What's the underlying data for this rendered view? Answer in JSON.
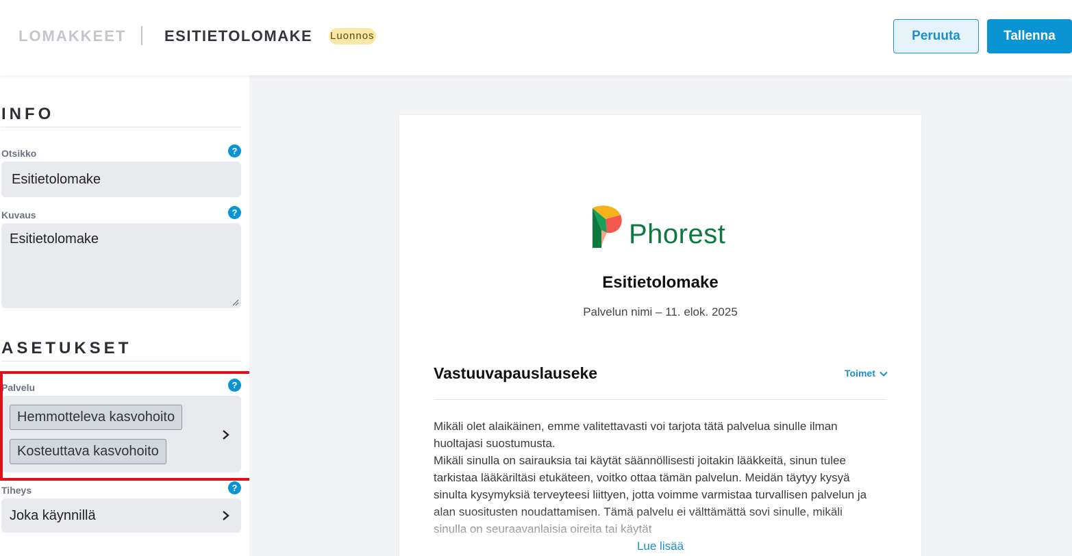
{
  "header": {
    "breadcrumb_root": "LOMAKKEET",
    "breadcrumb_current": "ESITIETOLOMAKE",
    "status_badge": "Luonnos",
    "cancel_label": "Peruuta",
    "save_label": "Tallenna"
  },
  "sidebar": {
    "info_title": "INFO",
    "title_label": "Otsikko",
    "title_value": "Esitietolomake",
    "description_label": "Kuvaus",
    "description_value": "Esitietolomake",
    "settings_title": "ASETUKSET",
    "service_label": "Palvelu",
    "services": [
      "Hemmotteleva kasvohoito",
      "Kosteuttava kasvohoito"
    ],
    "frequency_label": "Tiheys",
    "frequency_value": "Joka käynnillä",
    "help_glyph": "?"
  },
  "preview": {
    "logo_text": "Phorest",
    "form_title": "Esitietolomake",
    "form_subtitle": "Palvelun nimi – 11. elok. 2025",
    "block_title": "Vastuuvapauslauseke",
    "actions_label": "Toimet",
    "paragraph_1": "Mikäli olet alaikäinen, emme valitettavasti voi tarjota tätä palvelua sinulle ilman huoltajasi suostumusta.",
    "paragraph_2": "Mikäli sinulla on sairauksia tai käytät säännöllisesti joitakin lääkkeitä, sinun tulee tarkistaa lääkäriltäsi etukäteen, voitko ottaa tämän palvelun. Meidän täytyy kysyä sinulta kysymyksiä terveyteesi liittyen, jotta voimme varmistaa turvallisen palvelun ja alan suositusten noudattamisen. Tämä palvelu ei välttämättä sovi sinulle, mikäli sinulla on seuraavanlaisia oireita tai käytät",
    "read_more": "Lue lisää"
  },
  "colors": {
    "accent": "#0a94d3",
    "highlight": "#e0111a",
    "badge": "#fbe8a6",
    "logo_green": "#0c7a3e"
  },
  "icons": [
    "help-icon",
    "chevron-right-icon",
    "chevron-down-icon",
    "phorest-logo-icon",
    "resize-handle-icon"
  ]
}
